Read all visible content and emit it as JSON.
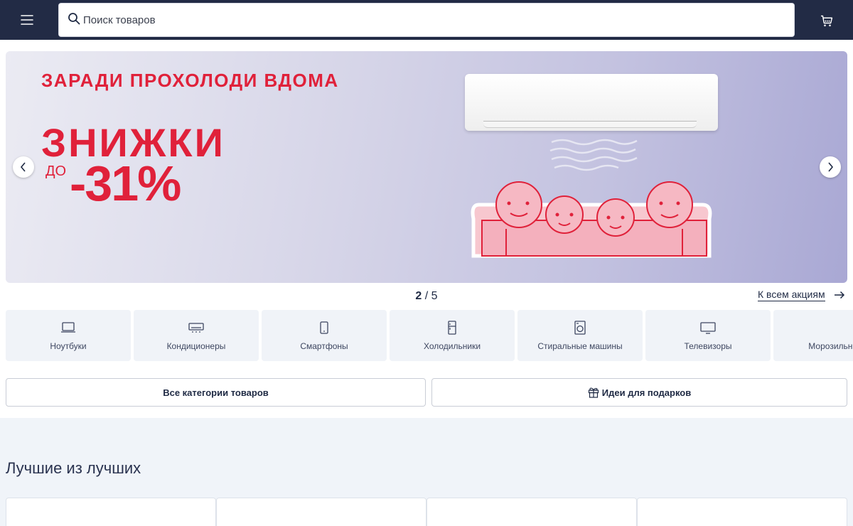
{
  "header": {
    "menu_icon": "hamburger-icon",
    "search": {
      "placeholder": "Поиск товаров",
      "icon": "search-icon"
    },
    "cart_icon": "cart-icon"
  },
  "banner": {
    "subtitle": "ЗАРАДИ ПРОХОЛОДИ ВДОМА",
    "title": "ЗНИЖКИ",
    "prefix": "ДО",
    "discount": "-31%",
    "accent_color": "#e0213a"
  },
  "carousel": {
    "current": "2",
    "separator": "/",
    "total": "5",
    "all_promos_label": "К всем акциям"
  },
  "categories": [
    {
      "label": "Ноутбуки",
      "icon": "laptop-icon"
    },
    {
      "label": "Кондиционеры",
      "icon": "air-conditioner-icon"
    },
    {
      "label": "Смартфоны",
      "icon": "smartphone-icon"
    },
    {
      "label": "Холодильники",
      "icon": "fridge-icon"
    },
    {
      "label": "Стиральные машины",
      "icon": "washing-machine-icon"
    },
    {
      "label": "Телевизоры",
      "icon": "tv-icon"
    },
    {
      "label": "Морозильные",
      "icon": "freezer-icon"
    }
  ],
  "buttons": {
    "all_categories": "Все категории товаров",
    "gift_ideas": "Идеи для подарков"
  },
  "best": {
    "title": "Лучшие из лучших"
  }
}
